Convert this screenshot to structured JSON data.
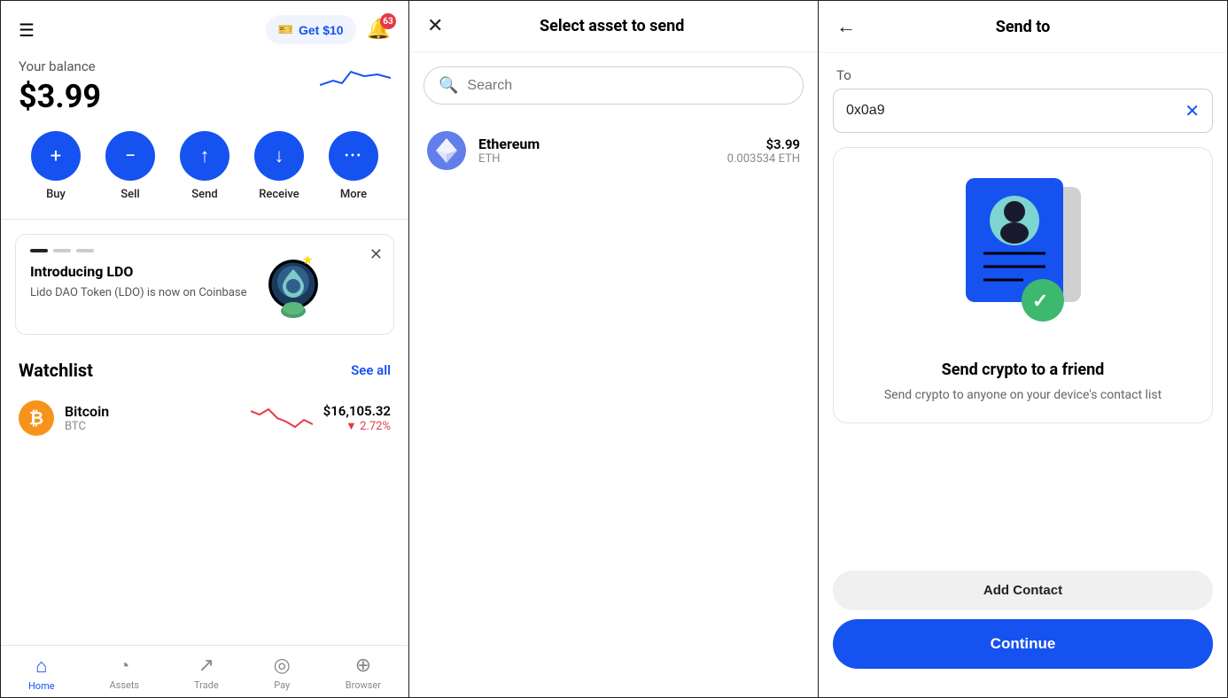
{
  "left": {
    "balance_label": "Your balance",
    "balance_value": "$3.99",
    "get_btn": "Get $10",
    "notif_count": "63",
    "actions": [
      {
        "label": "Buy",
        "icon": "+"
      },
      {
        "label": "Sell",
        "icon": "−"
      },
      {
        "label": "Send",
        "icon": "↑"
      },
      {
        "label": "Receive",
        "icon": "↓"
      },
      {
        "label": "More",
        "icon": "•••"
      }
    ],
    "promo_title": "Introducing LDO",
    "promo_desc": "Lido DAO Token (LDO) is now on Coinbase",
    "watchlist_title": "Watchlist",
    "see_all": "See all",
    "bitcoin_name": "Bitcoin",
    "bitcoin_symbol": "BTC",
    "bitcoin_price": "$16,105.32",
    "bitcoin_change": "▼ 2.72%",
    "nav": [
      {
        "label": "Home",
        "icon": "⌂",
        "active": true
      },
      {
        "label": "Assets",
        "icon": "○"
      },
      {
        "label": "Trade",
        "icon": "↗"
      },
      {
        "label": "Pay",
        "icon": "◎"
      },
      {
        "label": "Browser",
        "icon": "⊕"
      }
    ]
  },
  "mid": {
    "title": "Select asset to send",
    "search_placeholder": "Search",
    "asset_name": "Ethereum",
    "asset_symbol": "ETH",
    "asset_usd": "$3.99",
    "asset_eth": "0.003534 ETH"
  },
  "right": {
    "title": "Send to",
    "to_label": "To",
    "address_value": "0x0a9",
    "friend_title": "Send crypto to a friend",
    "friend_desc": "Send crypto to anyone on your device's contact list",
    "add_contact": "Add Contact",
    "continue": "Continue"
  }
}
